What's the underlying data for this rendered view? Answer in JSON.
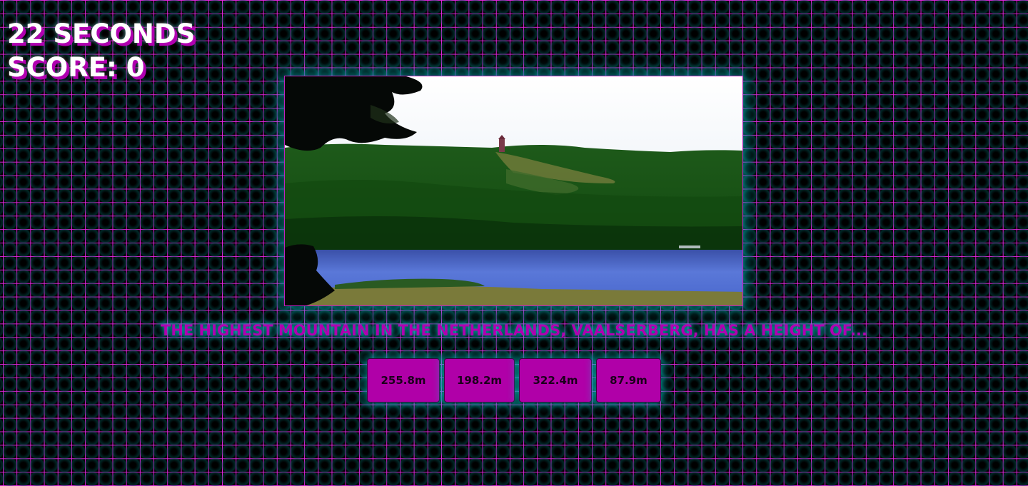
{
  "hud": {
    "timer": "22 SECONDS",
    "score": "SCORE: 0"
  },
  "question": {
    "text": "THE HIGHEST MOUNTAIN IN THE NETHERLANDS, VAALSERBERG, HAS A HEIGHT OF..."
  },
  "answers": [
    {
      "label": "255.8m"
    },
    {
      "label": "198.2m"
    },
    {
      "label": "322.4m"
    },
    {
      "label": "87.9m"
    }
  ],
  "colors": {
    "grid": "#e628e6",
    "glow": "#00c8c8",
    "accent": "#b000b0",
    "text": "#ffffff"
  }
}
